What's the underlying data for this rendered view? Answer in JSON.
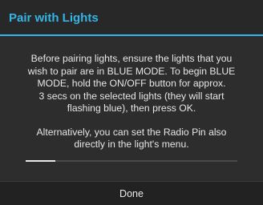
{
  "dialog": {
    "title": "Pair with Lights",
    "message_line1": "Before pairing lights, ensure the lights that you",
    "message_line2": "wish to pair are in BLUE MODE. To begin BLUE",
    "message_line3": "MODE, hold the ON/OFF button for approx.",
    "message_line4": "3 secs on the selected lights (they will start",
    "message_line5": "flashing blue), then press OK.",
    "message_line6": "Alternatively, you can set the Radio Pin also",
    "message_line7": "directly in the light's menu.",
    "progress_fraction": 0.14,
    "done_label": "Done"
  },
  "colors": {
    "accent": "#33b5e5",
    "background": "#2d2d2d",
    "text": "#e6e6e6"
  }
}
